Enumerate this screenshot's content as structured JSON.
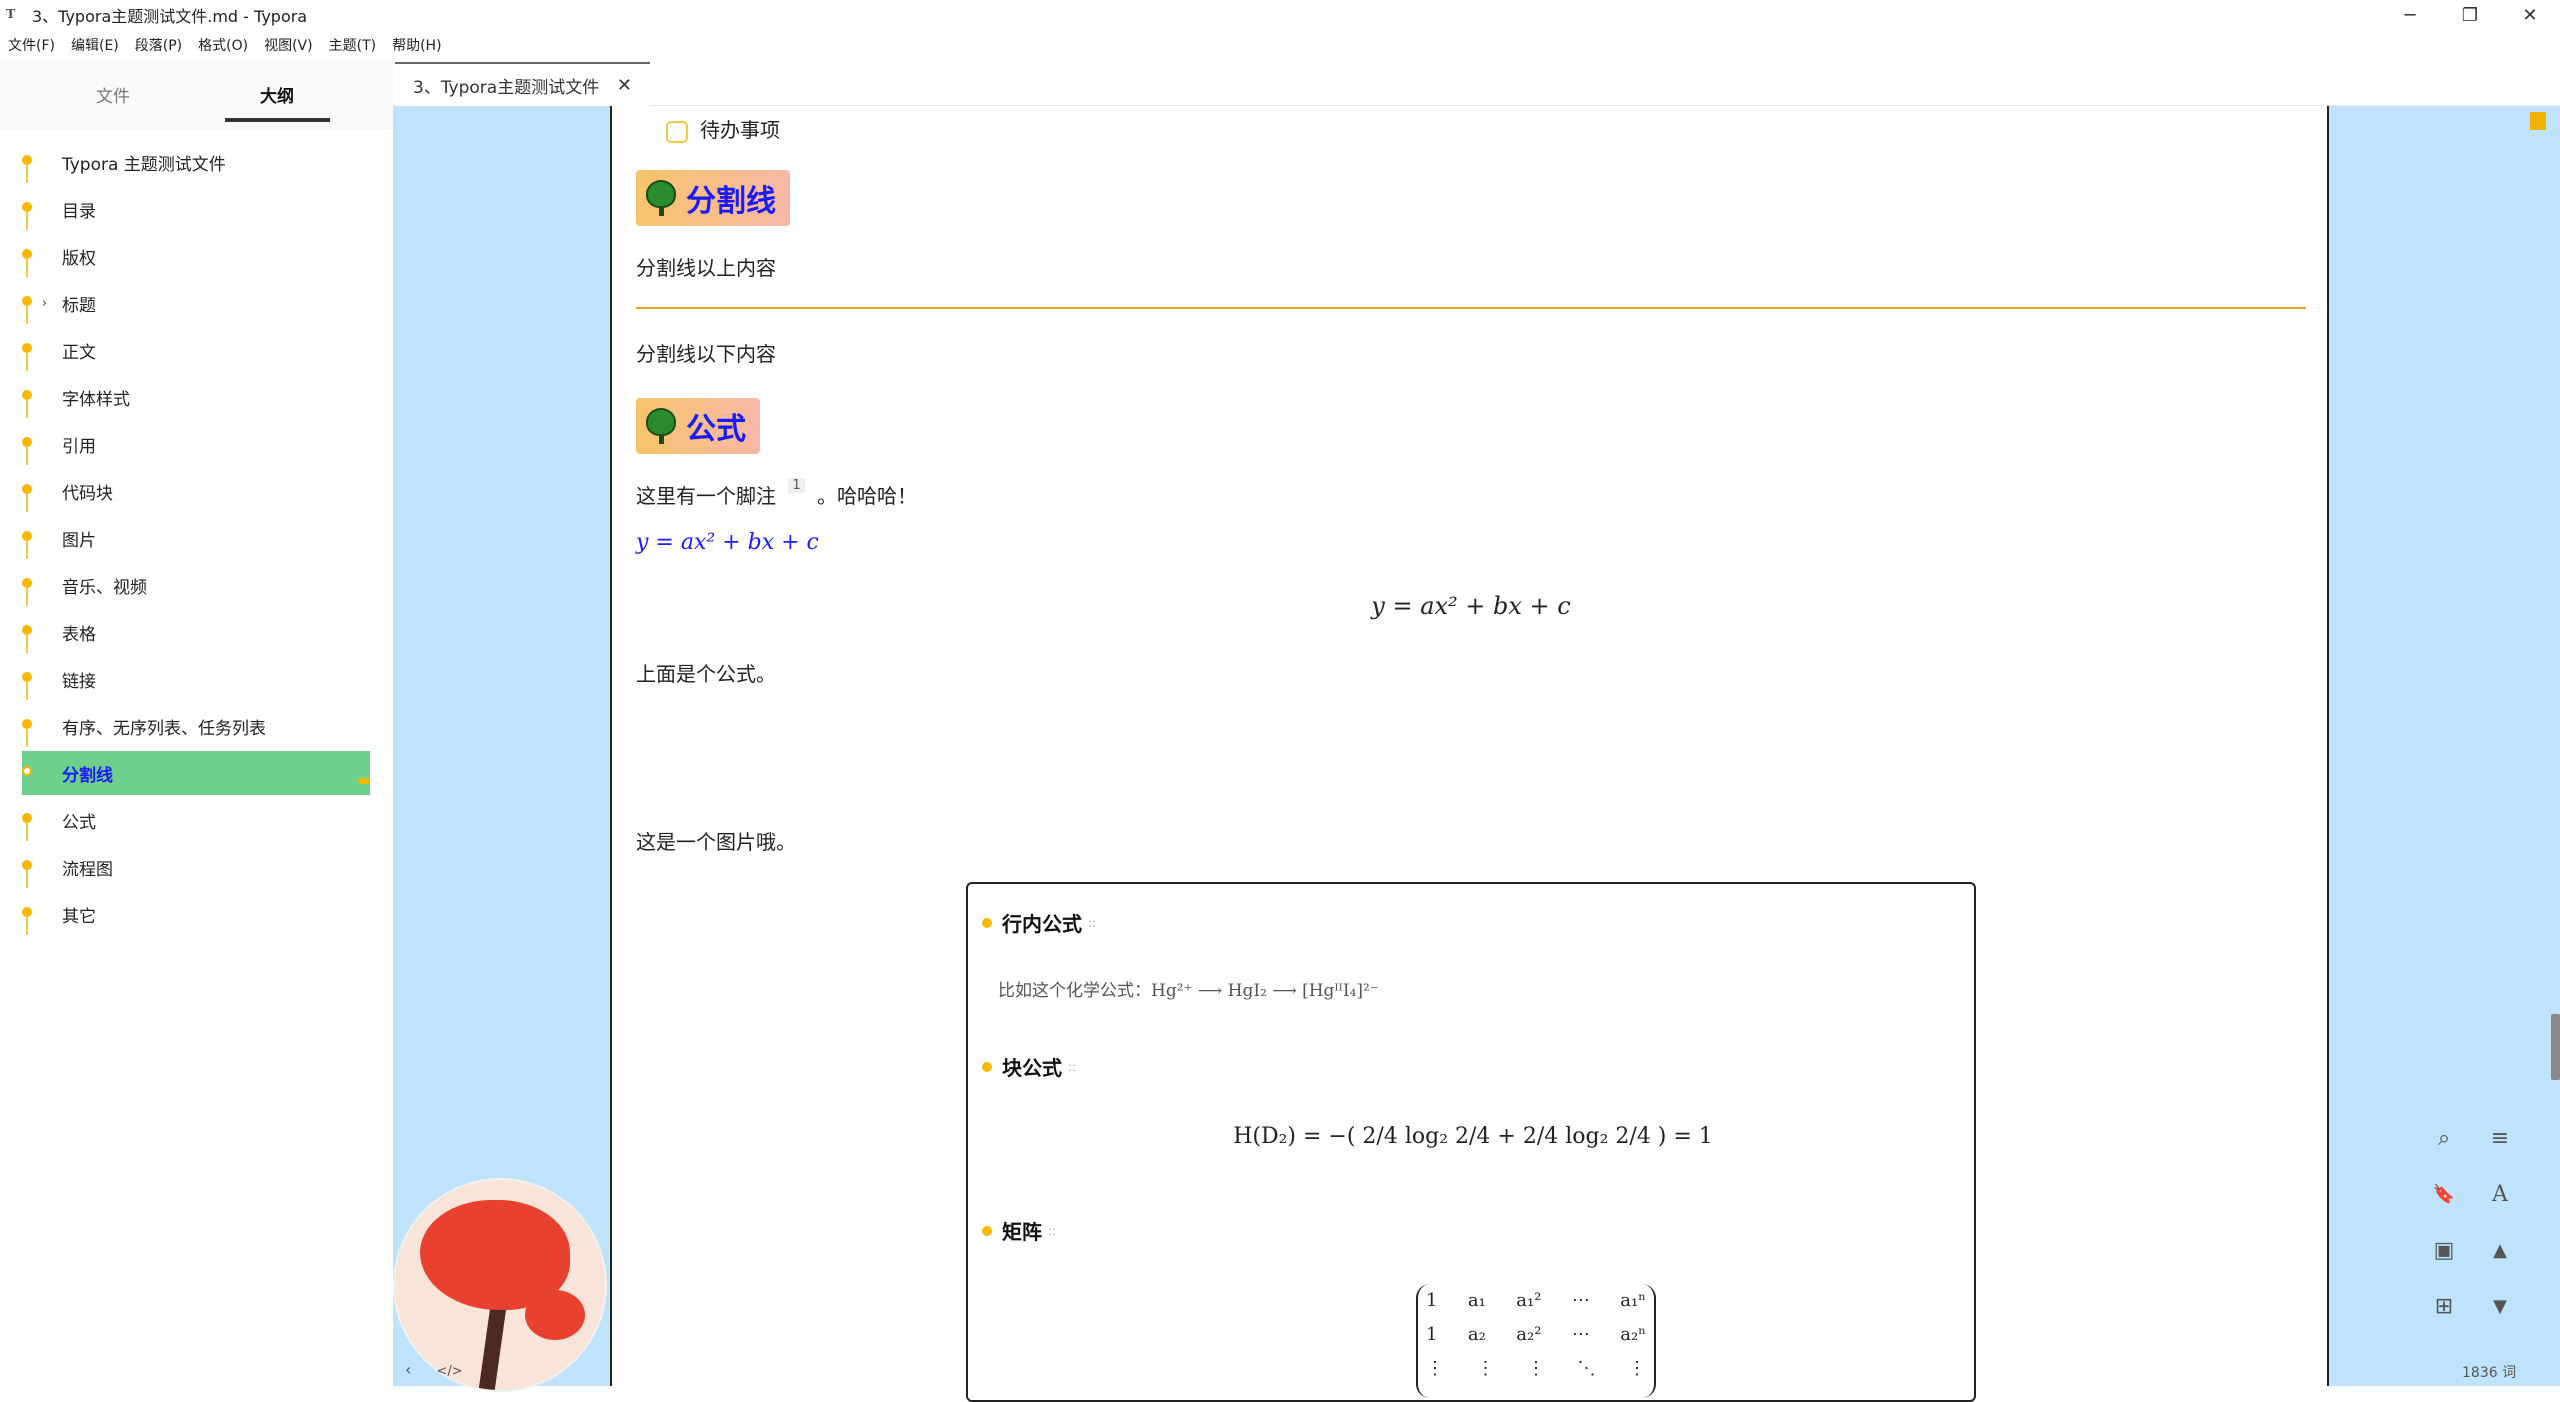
{
  "window": {
    "app_icon": "T",
    "title": "3、Typora主题测试文件.md - Typora",
    "minimize": "─",
    "maximize": "❐",
    "close": "✕"
  },
  "menu": [
    "文件(F)",
    "编辑(E)",
    "段落(P)",
    "格式(O)",
    "视图(V)",
    "主题(T)",
    "帮助(H)"
  ],
  "sidebar": {
    "tab_files": "文件",
    "tab_outline": "大纲",
    "outline": [
      {
        "label": "Typora 主题测试文件",
        "expandable": false
      },
      {
        "label": "目录",
        "expandable": false
      },
      {
        "label": "版权",
        "expandable": false
      },
      {
        "label": "标题",
        "expandable": true
      },
      {
        "label": "正文",
        "expandable": false
      },
      {
        "label": "字体样式",
        "expandable": false
      },
      {
        "label": "引用",
        "expandable": false
      },
      {
        "label": "代码块",
        "expandable": false
      },
      {
        "label": "图片",
        "expandable": false
      },
      {
        "label": "音乐、视频",
        "expandable": false
      },
      {
        "label": "表格",
        "expandable": false
      },
      {
        "label": "链接",
        "expandable": false
      },
      {
        "label": "有序、无序列表、任务列表",
        "expandable": false
      },
      {
        "label": "分割线",
        "expandable": false,
        "active": true
      },
      {
        "label": "公式",
        "expandable": false
      },
      {
        "label": "流程图",
        "expandable": false
      },
      {
        "label": "其它",
        "expandable": false
      }
    ],
    "chevron": "›"
  },
  "tab": {
    "title": "3、Typora主题测试文件",
    "close": "✕"
  },
  "doc": {
    "task_item": "待办事项",
    "heading_hr": "分割线",
    "above_hr": "分割线以上内容",
    "below_hr": "分割线以下内容",
    "heading_formula": "公式",
    "footnote_text": "这里有一个脚注",
    "footnote_ref": "1",
    "footnote_tail": "。哈哈哈！",
    "inline_formula": "y = ax² + bx + c",
    "display_formula": "y = ax² + bx + c",
    "after_formula": "上面是个公式。",
    "image_caption": "这是一个图片哦。"
  },
  "image": {
    "sec1": "行内公式",
    "chem": "比如这个化学公式：Hg²⁺ ⟶ HgI₂ ⟶ [HgᴵᴵI₄]²⁻",
    "sec2": "块公式",
    "hd": "H(D₂) = −( 2/4 log₂ 2/4 + 2/4 log₂ 2/4 ) = 1",
    "sec3": "矩阵",
    "drag": "::",
    "matrix": [
      [
        "1",
        "a₁",
        "a₁²",
        "⋯",
        "a₁ⁿ"
      ],
      [
        "1",
        "a₂",
        "a₂²",
        "⋯",
        "a₂ⁿ"
      ],
      [
        "⋮",
        "⋮",
        "⋮",
        "⋱",
        "⋮"
      ]
    ]
  },
  "footer": {
    "collapse": "‹",
    "source_mode": "</>",
    "word_count": "1836 词"
  },
  "tools": {
    "search": "⌕",
    "outline": "≡",
    "bookmark": "🔖",
    "font": "A",
    "image": "▣",
    "up": "▲",
    "down": "▼",
    "tree": "⊞"
  }
}
